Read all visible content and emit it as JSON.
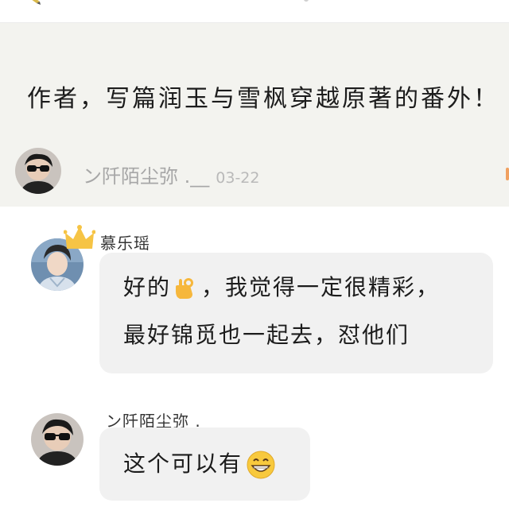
{
  "post": {
    "text": "作者，写篇润玉与雪枫穿越原著的番外！",
    "author": "ン阡陌尘弥 .__",
    "date": "03-22"
  },
  "comments": [
    {
      "author": "慕乐瑶",
      "line1_before": "好的",
      "line1_after": "，我觉得一定很精彩，",
      "line2": "最好锦觅也一起去，怼他们"
    },
    {
      "author": "ン阡陌尘弥 .__",
      "text": "这个可以有"
    }
  ],
  "icons": {
    "ok_emoji": "ok-hand-icon",
    "grin_emoji": "grinning-face-icon",
    "crown": "crown-icon"
  },
  "colors": {
    "post_background": "#f3f3ef",
    "bubble_background": "#f1f1f1",
    "author_gray": "#a7a7a7",
    "crown_yellow": "#f6c445"
  }
}
